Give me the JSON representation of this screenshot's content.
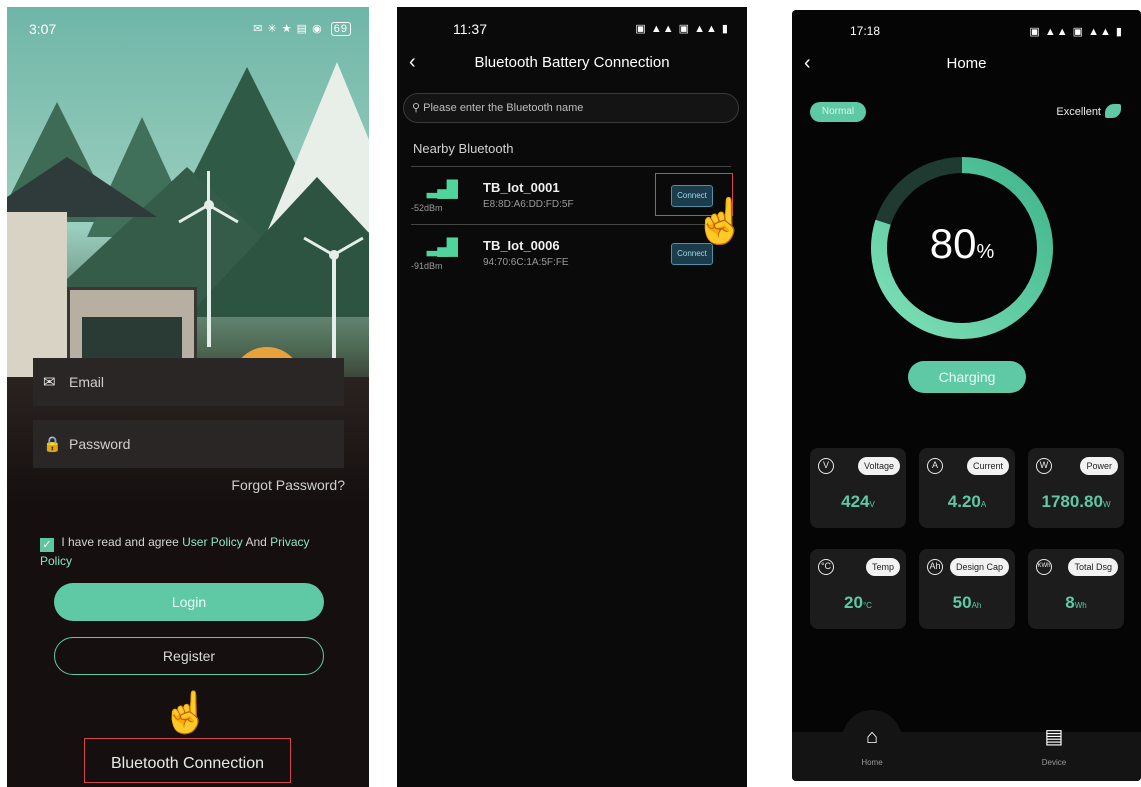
{
  "login_screen": {
    "status_time": "3:07",
    "status_icons": "✉ ✳ ★ ▤ ◉",
    "battery": "69",
    "email_placeholder": "Email",
    "password_placeholder": "Password",
    "forgot_password": "Forgot Password?",
    "agree_prefix": "I have read and agree",
    "agree_link_user": "User Policy",
    "agree_and": "And",
    "agree_link_privacy": "Privacy Policy",
    "login_label": "Login",
    "register_label": "Register",
    "bluetooth_label": "Bluetooth Connection"
  },
  "bluetooth_screen": {
    "status_time": "11:37",
    "title": "Bluetooth Battery Connection",
    "search_placeholder": "Please enter the Bluetooth name",
    "section_title": "Nearby Bluetooth",
    "devices": [
      {
        "name": "TB_Iot_0001",
        "mac": "E8:8D:A6:DD:FD:5F",
        "rssi": "-52dBm",
        "button": "Connect"
      },
      {
        "name": "TB_Iot_0006",
        "mac": "94:70:6C:1A:5F:FE",
        "rssi": "-91dBm",
        "button": "Connect"
      }
    ]
  },
  "home_screen": {
    "status_time": "17:18",
    "title": "Home",
    "status_badge": "Normal",
    "health": "Excellent",
    "soc_value": "80",
    "soc_unit": "%",
    "soc_fraction": 0.8,
    "charging_label": "Charging",
    "metrics": [
      {
        "label": "Voltage",
        "value": "424",
        "unit": "V",
        "icon": "V"
      },
      {
        "label": "Current",
        "value": "4.20",
        "unit": "A",
        "icon": "A"
      },
      {
        "label": "Power",
        "value": "1780.80",
        "unit": "W",
        "icon": "W"
      },
      {
        "label": "Temp",
        "value": "20",
        "unit": "°C",
        "icon": "°C"
      },
      {
        "label": "Design Cap",
        "value": "50",
        "unit": "Ah",
        "icon": "Ah"
      },
      {
        "label": "Total Dsg",
        "value": "8",
        "unit": "Wh",
        "icon": "KWh"
      }
    ],
    "tabs": {
      "home": "Home",
      "device": "Device"
    }
  },
  "colors": {
    "accent": "#5ec9a4",
    "highlight_box": "#d24848"
  }
}
